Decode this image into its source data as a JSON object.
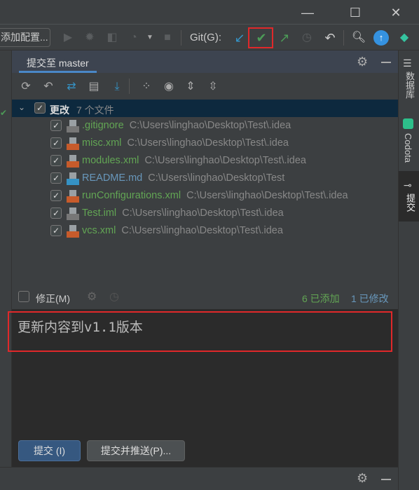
{
  "window": {
    "minimize": "—",
    "maximize": "☐",
    "close": "✕"
  },
  "toolbar": {
    "config_label": "添加配置...",
    "git_label": "Git(G):"
  },
  "colors": {
    "accent": "#4a88c7",
    "added": "#62a554",
    "modified": "#6897bb",
    "highlight": "#e0282a",
    "commit_button": "#365880"
  },
  "commit_tab": {
    "label": "提交至 master"
  },
  "tree": {
    "group_label": "更改",
    "group_count": "7 个文件",
    "files": [
      {
        "name": ".gitignore",
        "path": "C:\\Users\\linghao\\Desktop\\Test\\.idea",
        "status": "added",
        "icon": "ignore-file-icon"
      },
      {
        "name": "misc.xml",
        "path": "C:\\Users\\linghao\\Desktop\\Test\\.idea",
        "status": "added",
        "icon": "xml-file-icon"
      },
      {
        "name": "modules.xml",
        "path": "C:\\Users\\linghao\\Desktop\\Test\\.idea",
        "status": "added",
        "icon": "xml-file-icon"
      },
      {
        "name": "README.md",
        "path": "C:\\Users\\linghao\\Desktop\\Test",
        "status": "modified",
        "icon": "markdown-file-icon"
      },
      {
        "name": "runConfigurations.xml",
        "path": "C:\\Users\\linghao\\Desktop\\Test\\.idea",
        "status": "added",
        "icon": "xml-file-icon"
      },
      {
        "name": "Test.iml",
        "path": "C:\\Users\\linghao\\Desktop\\Test\\.idea",
        "status": "added",
        "icon": "iml-file-icon"
      },
      {
        "name": "vcs.xml",
        "path": "C:\\Users\\linghao\\Desktop\\Test\\.idea",
        "status": "added",
        "icon": "xml-file-icon"
      }
    ]
  },
  "amend": {
    "label": "修正(M)",
    "added": "6 已添加",
    "modified": "1 已修改"
  },
  "commit_message": "更新内容到v1.1版本",
  "buttons": {
    "commit": "提交 (I)",
    "commit_push": "提交并推送(P)..."
  },
  "sidebar": {
    "database": "数据库",
    "codota": "Codota",
    "commit": "提交"
  }
}
